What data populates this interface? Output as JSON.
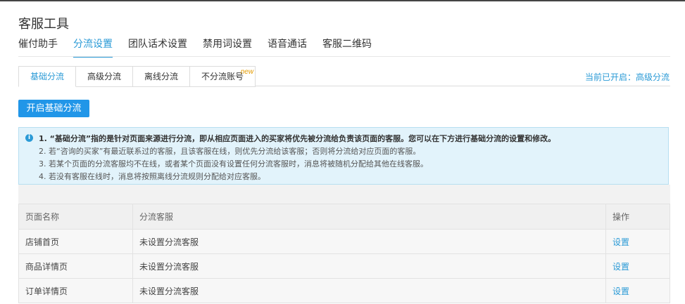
{
  "page": {
    "title": "客服工具"
  },
  "main_tabs": [
    "催付助手",
    "分流设置",
    "团队话术设置",
    "禁用词设置",
    "语音通话",
    "客服二维码"
  ],
  "sub_tabs": [
    "基础分流",
    "高级分流",
    "离线分流",
    "不分流账号"
  ],
  "new_badge": "new",
  "status_text": "当前已开启：高级分流",
  "enable_button": "开启基础分流",
  "info": {
    "icon": "i",
    "lines": [
      "1. “基础分流”指的是针对页面来源进行分流，即从相应页面进入的买家将优先被分流给负责该页面的客服。您可以在下方进行基础分流的设置和修改。",
      "2. 若“咨询的买家”有最近联系过的客服，且该客服在线，则优先分流给该客服；否则将分流给对应页面的客服。",
      "3. 若某个页面的分流客服均不在线，或者某个页面没有设置任何分流客服时，消息将被随机分配给其他在线客服。",
      "4. 若没有客服在线时，消息将按照离线分流规则分配给对应客服。"
    ]
  },
  "table": {
    "headers": [
      "页面名称",
      "分流客服",
      "操作"
    ],
    "rows": [
      {
        "page": "店铺首页",
        "agent": "未设置分流客服",
        "action": "设置"
      },
      {
        "page": "商品详情页",
        "agent": "未设置分流客服",
        "action": "设置"
      },
      {
        "page": "订单详情页",
        "agent": "未设置分流客服",
        "action": "设置"
      }
    ]
  },
  "colors": {
    "accent": "#2a9ad6",
    "button": "#2196e8",
    "info_bg": "#e2f3fb",
    "badge": "#e39b00"
  }
}
